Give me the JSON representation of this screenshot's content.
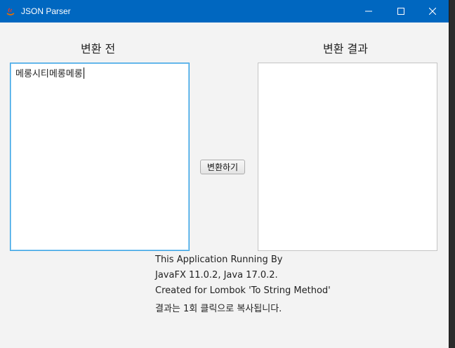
{
  "window": {
    "title": "JSON Parser",
    "icon": "java-cup-icon",
    "controls": [
      "minimize-icon",
      "maximize-icon",
      "close-icon"
    ]
  },
  "input_panel": {
    "heading": "변환 전",
    "value": "메롱시티메롱메롱"
  },
  "output_panel": {
    "heading": "변환 결과",
    "value": ""
  },
  "convert_button": {
    "label": "변환하기"
  },
  "info": {
    "line1": "This Application Running By",
    "line2": "JavaFX 11.0.2, Java 17.0.2.",
    "line3": "Created for Lombok 'To String Method'",
    "line4": "결과는 1회 클릭으로 복사됩니다."
  },
  "colors": {
    "titlebar": "#0067c0",
    "focus_border": "#3aa3e3",
    "window_bg": "#f3f3f3"
  }
}
